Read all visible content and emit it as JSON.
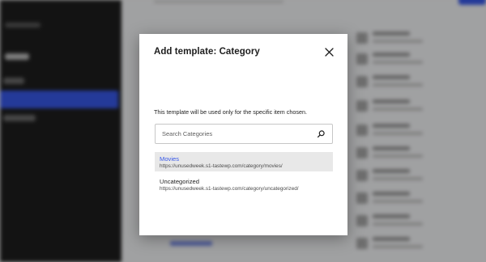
{
  "modal": {
    "title": "Add template: Category",
    "close_label": "Close",
    "description": "This template will be used only for the specific item chosen.",
    "search": {
      "placeholder": "Search Categories",
      "value": ""
    },
    "results": [
      {
        "name": "Movies",
        "url": "https://unusedweek.s1-tastewp.com/category/movies/",
        "highlighted": true
      },
      {
        "name": "Uncategorized",
        "url": "https://unusedweek.s1-tastewp.com/category/uncategorized/",
        "highlighted": false
      }
    ]
  },
  "colors": {
    "accent": "#3858e9",
    "sidebar": "#1e1e1e",
    "overlay": "rgba(0,0,0,0.34)",
    "highlight_row": "#e8e8e8"
  },
  "icons": {
    "close": "close-icon",
    "search": "search-icon"
  }
}
